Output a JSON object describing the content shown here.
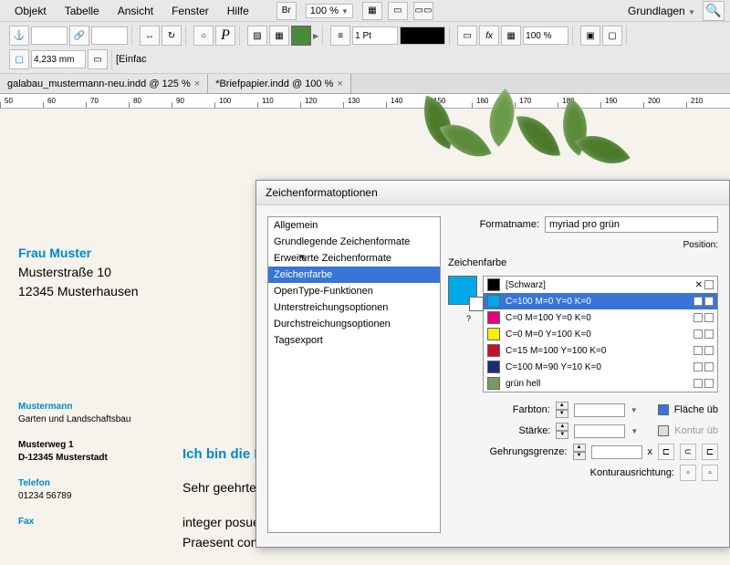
{
  "menubar": {
    "items": [
      "Objekt",
      "Tabelle",
      "Ansicht",
      "Fenster",
      "Hilfe"
    ],
    "br_label": "Br",
    "zoom": "100 %",
    "workspace": "Grundlagen"
  },
  "toolbar": {
    "stroke_weight": "1 Pt",
    "opacity": "100 %",
    "dimension": "4,233 mm",
    "right_label": "[Einfac"
  },
  "tabs": [
    {
      "label": "galabau_mustermann-neu.indd @ 125 %"
    },
    {
      "label": "*Briefpapier.indd @ 100 %"
    }
  ],
  "ruler_marks": [
    "50",
    "60",
    "70",
    "80",
    "90",
    "100",
    "110",
    "120",
    "130",
    "140",
    "150",
    "160",
    "170",
    "180",
    "190",
    "200",
    "210"
  ],
  "document": {
    "address_name": "Frau Muster",
    "address_street": "Musterstraße 10",
    "address_city": "12345 Musterhausen",
    "footer_company": "Mustermann",
    "footer_subtitle": "Garten und Landschaftsbau",
    "footer_street": "Musterweg 1",
    "footer_city": "D-12345 Musterstadt",
    "footer_phone_label": "Telefon",
    "footer_phone": "01234 56789",
    "footer_fax_label": "Fax",
    "body_heading": "Ich bin die H",
    "body_greeting": "Sehr geehrte F",
    "body_p1": "integer posue",
    "body_p2": "Praesent com"
  },
  "dialog": {
    "title": "Zeichenformatoptionen",
    "format_name_label": "Formatname:",
    "format_name": "myriad pro grün",
    "position_label": "Position:",
    "list_items": [
      "Allgemein",
      "Grundlegende Zeichenformate",
      "Erweiterte Zeichenformate",
      "Zeichenfarbe",
      "OpenType-Funktionen",
      "Unterstreichungsoptionen",
      "Durchstreichungsoptionen",
      "Tagsexport"
    ],
    "selected_index": 3,
    "section_title": "Zeichenfarbe",
    "swatches": [
      {
        "name": "[Schwarz]",
        "color": "#000000"
      },
      {
        "name": "C=100 M=0 Y=0 K=0",
        "color": "#00a8e8"
      },
      {
        "name": "C=0 M=100 Y=0 K=0",
        "color": "#e6007e"
      },
      {
        "name": "C=0 M=0 Y=100 K=0",
        "color": "#ffed00"
      },
      {
        "name": "C=15 M=100 Y=100 K=0",
        "color": "#c8102e"
      },
      {
        "name": "C=100 M=90 Y=10 K=0",
        "color": "#1e2a78"
      },
      {
        "name": "grün hell",
        "color": "#7a9a5a"
      }
    ],
    "selected_swatch": 1,
    "tint_label": "Farbton:",
    "fill_over_label": "Fläche üb",
    "weight_label": "Stärke:",
    "stroke_over_label": "Kontur üb",
    "miter_label": "Gehrungsgrenze:",
    "align_label": "Konturausrichtung:",
    "x_label": "x"
  }
}
